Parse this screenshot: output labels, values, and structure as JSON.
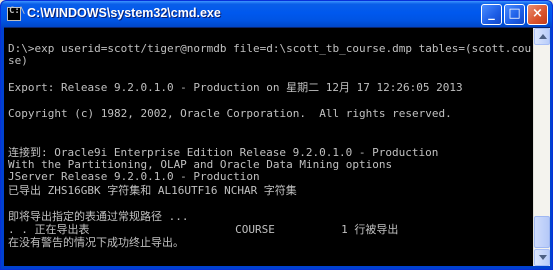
{
  "window": {
    "title": "C:\\WINDOWS\\system32\\cmd.exe",
    "controls": {
      "minimize": "_",
      "maximize": "□",
      "close": "×"
    }
  },
  "icon": {
    "name": "cmd-icon",
    "glyph": "C:\\"
  },
  "console": {
    "lines": [
      "",
      "D:\\>exp userid=scott/tiger@normdb file=d:\\scott_tb_course.dmp tables=(scott.cour",
      "se)",
      "",
      "Export: Release 9.2.0.1.0 - Production on 星期二 12月 17 12:26:05 2013",
      "",
      "Copyright (c) 1982, 2002, Oracle Corporation.  All rights reserved.",
      "",
      "",
      "连接到: Oracle9i Enterprise Edition Release 9.2.0.1.0 - Production",
      "With the Partitioning, OLAP and Oracle Data Mining options",
      "JServer Release 9.2.0.1.0 - Production",
      "已导出 ZHS16GBK 字符集和 AL16UTF16 NCHAR 字符集",
      "",
      "即将导出指定的表通过常规路径 ...",
      ". . 正在导出表                      COURSE          1 行被导出",
      "在没有警告的情况下成功终止导出。",
      ""
    ]
  }
}
